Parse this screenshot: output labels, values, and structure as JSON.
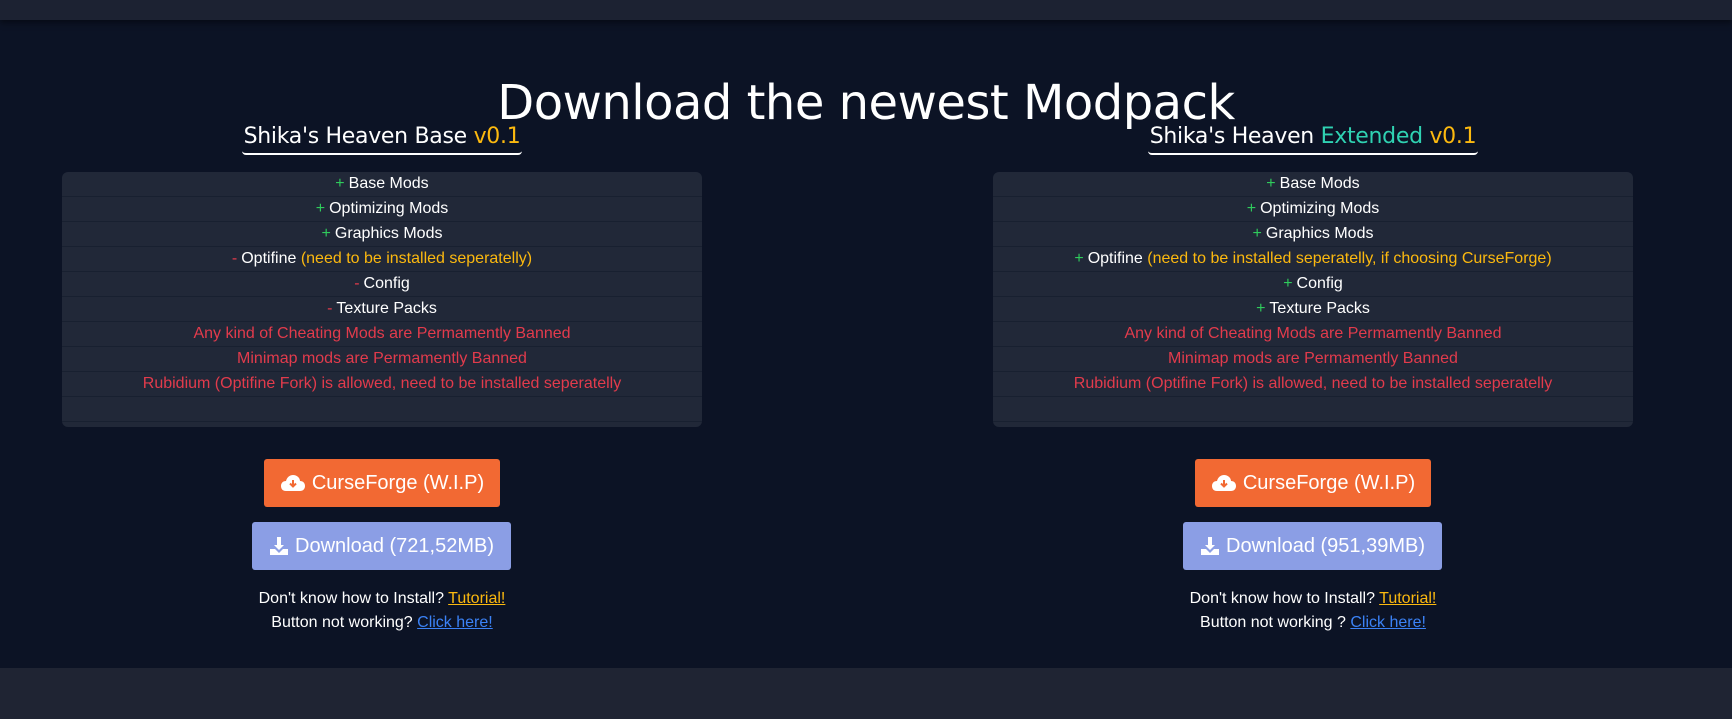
{
  "page": {
    "title": "Download the newest Modpack"
  },
  "columns": [
    {
      "title_main": "Shika's Heaven Base ",
      "title_extra": "",
      "title_version": "v0.1",
      "features": [
        {
          "sign": "+",
          "text": "Base Mods",
          "note": ""
        },
        {
          "sign": "+",
          "text": "Optimizing Mods",
          "note": ""
        },
        {
          "sign": "+",
          "text": "Graphics Mods",
          "note": ""
        },
        {
          "sign": "-",
          "text": "Optifine ",
          "note": "(need to be installed seperatelly)"
        },
        {
          "sign": "-",
          "text": "Config",
          "note": ""
        },
        {
          "sign": "-",
          "text": "Texture Packs",
          "note": ""
        }
      ],
      "warnings": [
        "Any kind of Cheating Mods are Permamently Banned",
        "Minimap mods are Permamently Banned",
        "Rubidium (Optifine Fork) is allowed, need to be installed seperatelly"
      ],
      "curseforge_label": "CurseForge (W.I.P)",
      "download_label": "Download (721,52MB)",
      "help_install_text": "Don't know how to Install? ",
      "help_install_link": "Tutorial!",
      "help_button_text": "Button not working? ",
      "help_button_link": "Click here!"
    },
    {
      "title_main": "Shika's Heaven ",
      "title_extra": "Extended ",
      "title_version": "v0.1",
      "features": [
        {
          "sign": "+",
          "text": "Base Mods",
          "note": ""
        },
        {
          "sign": "+",
          "text": "Optimizing Mods",
          "note": ""
        },
        {
          "sign": "+",
          "text": "Graphics Mods",
          "note": ""
        },
        {
          "sign": "+",
          "text": "Optifine ",
          "note": "(need to be installed seperatelly, if choosing CurseForge)"
        },
        {
          "sign": "+",
          "text": "Config",
          "note": ""
        },
        {
          "sign": "+",
          "text": "Texture Packs",
          "note": ""
        }
      ],
      "warnings": [
        "Any kind of Cheating Mods are Permamently Banned",
        "Minimap mods are Permamently Banned",
        "Rubidium (Optifine Fork) is allowed, need to be installed seperatelly"
      ],
      "curseforge_label": "CurseForge (W.I.P)",
      "download_label": "Download (951,39MB)",
      "help_install_text": "Don't know how to Install? ",
      "help_install_link": "Tutorial!",
      "help_button_text": "Button not working ? ",
      "help_button_link": "Click here!"
    }
  ],
  "colors": {
    "background": "#0c1325",
    "panel": "#212838",
    "curseforge": "#f26933",
    "download": "#8b9ee5",
    "version": "#fcb90f",
    "extended": "#2fd2b2",
    "plus": "#2fcb5c",
    "minus": "#e23b4c",
    "link": "#3b82f6"
  },
  "icons": {
    "curseforge": "cloud-download-icon",
    "download": "download-icon"
  }
}
